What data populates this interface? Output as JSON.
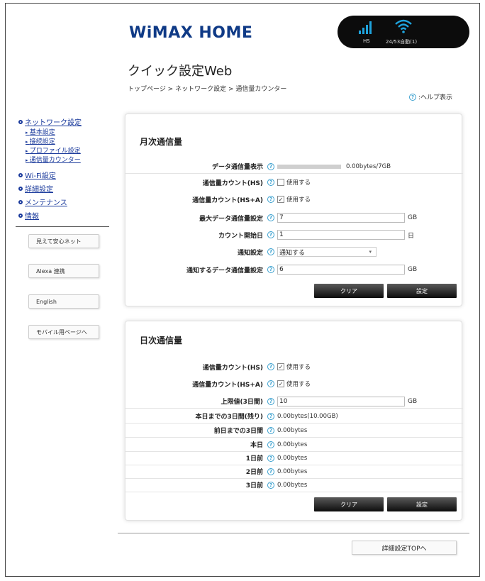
{
  "brand": {
    "logo": "WiMAX HOME",
    "accent": "#0f3a86",
    "link_color": "#1a3a9c"
  },
  "status": {
    "mode": "HS",
    "speed": "24/53自動(1)",
    "signal_icon": "signal-bars-icon",
    "wifi_icon": "wifi-icon"
  },
  "page_title": "クイック設定Web",
  "breadcrumb": "トップページ > ネットワーク設定 > 通信量カウンター",
  "help_label": ":ヘルプ表示",
  "sidebar": {
    "sections": [
      {
        "label": "ネットワーク設定",
        "subs": [
          "基本設定",
          "接続設定",
          "プロファイル設定",
          "通信量カウンター"
        ]
      },
      {
        "label": "Wi-Fi設定"
      },
      {
        "label": "詳細設定"
      },
      {
        "label": "メンテナンス"
      },
      {
        "label": "情報"
      }
    ],
    "buttons": [
      "見えて安心ネット",
      "Alexa 連携",
      "English",
      "モバイル用ページへ"
    ]
  },
  "monthly": {
    "title": "月次通信量",
    "usage_label": "データ通信量表示",
    "usage_value": "0.00bytes/7GB",
    "usage_fraction": 0,
    "hs_count_label": "通信量カウント(HS)",
    "hs_count_text": "使用する",
    "hs_count_checked": false,
    "hsa_count_label": "通信量カウント(HS+A)",
    "hsa_count_text": "使用する",
    "hsa_count_checked": true,
    "max_label": "最大データ通信量設定",
    "max_value": "7",
    "max_unit": "GB",
    "start_label": "カウント開始日",
    "start_value": "1",
    "start_unit": "日",
    "notify_label": "通知設定",
    "notify_value": "通知する",
    "notify_amount_label": "通知するデータ通信量設定",
    "notify_amount_value": "6",
    "notify_amount_unit": "GB",
    "clear_button": "クリア",
    "set_button": "設定"
  },
  "daily": {
    "title": "日次通信量",
    "hs_count_label": "通信量カウント(HS)",
    "hs_count_text": "使用する",
    "hs_count_checked": true,
    "hsa_count_label": "通信量カウント(HS+A)",
    "hsa_count_text": "使用する",
    "hsa_count_checked": true,
    "limit_label": "上限値(3日間)",
    "limit_value": "10",
    "limit_unit": "GB",
    "rows": [
      {
        "label": "本日までの3日間(残り)",
        "value": "0.00bytes(10.00GB)"
      },
      {
        "label": "前日までの3日間",
        "value": "0.00bytes"
      },
      {
        "label": "本日",
        "value": "0.00bytes"
      },
      {
        "label": "1日前",
        "value": "0.00bytes"
      },
      {
        "label": "2日前",
        "value": "0.00bytes"
      },
      {
        "label": "3日前",
        "value": "0.00bytes"
      }
    ],
    "clear_button": "クリア",
    "set_button": "設定"
  },
  "footer_button": "詳細設定TOPへ"
}
